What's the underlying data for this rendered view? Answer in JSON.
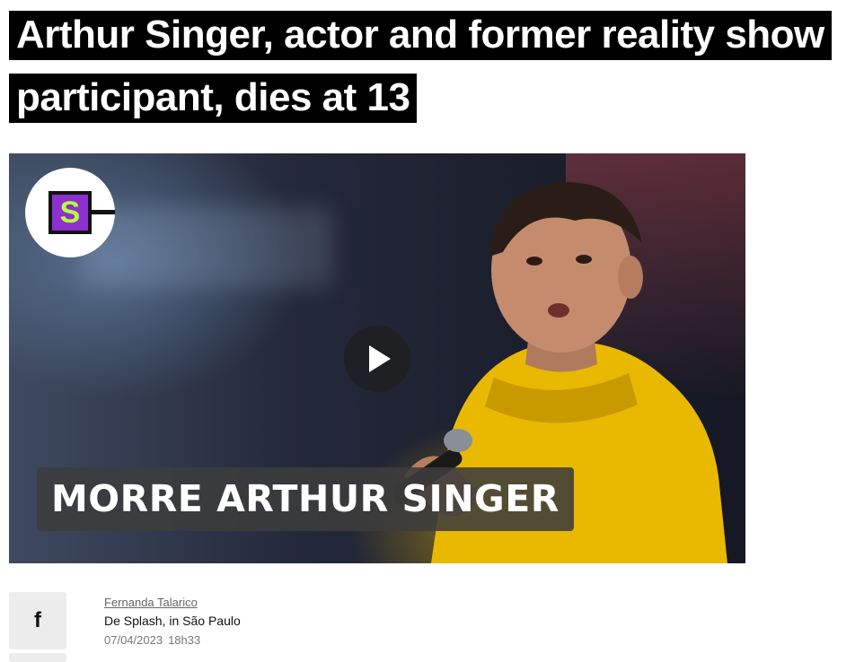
{
  "article": {
    "headline": "Arthur Singer, actor and former reality show participant, dies at 13"
  },
  "video": {
    "caption": "MORRE ARTHUR SINGER",
    "logo_letter": "S",
    "play_icon": "play-icon",
    "colors": {
      "logo_purple": "#8e2fd0",
      "logo_green": "#b8ff3c",
      "hoodie_yellow": "#f2c200"
    }
  },
  "share": {
    "facebook_icon": "facebook-icon",
    "facebook_glyph": "f"
  },
  "byline": {
    "author": "Fernanda Talarico",
    "source": "De Splash, in São Paulo",
    "date": "07/04/2023",
    "time": "18h33"
  }
}
